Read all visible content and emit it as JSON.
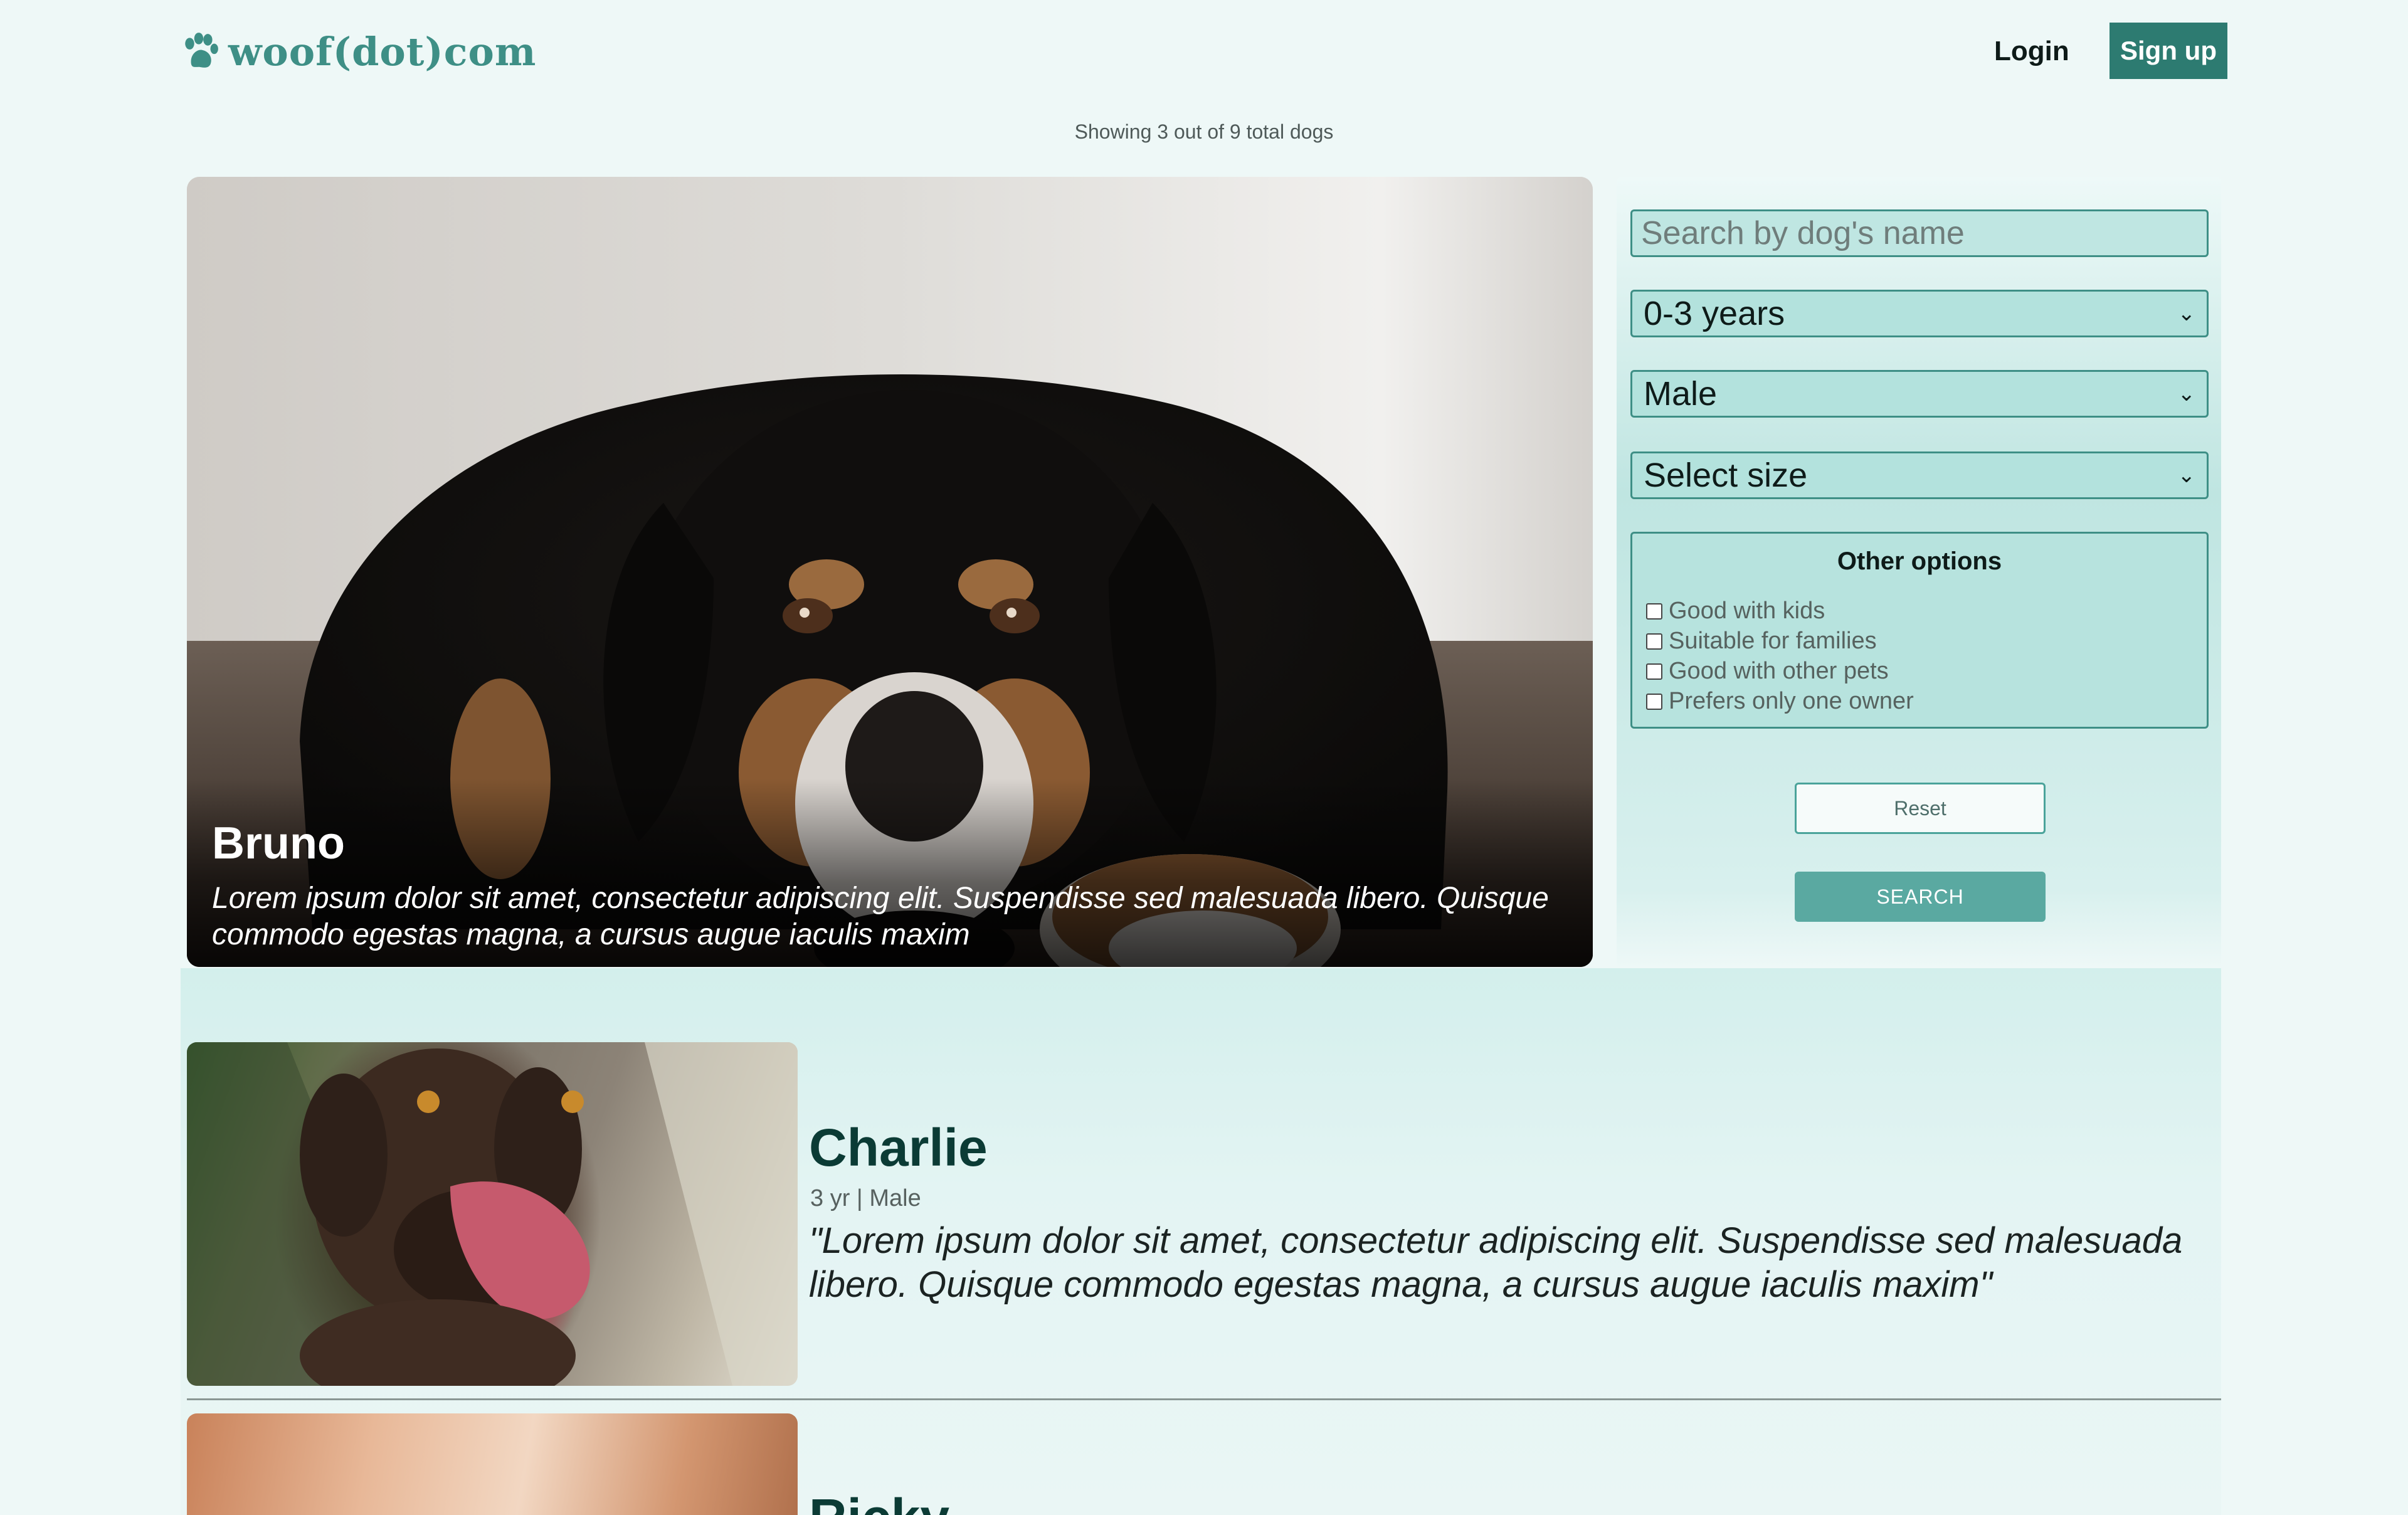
{
  "header": {
    "brand": "woof(dot)com",
    "login_label": "Login",
    "signup_label": "Sign up"
  },
  "summary": "Showing 3 out of 9 total dogs",
  "featured": {
    "name": "Bruno",
    "description": "Lorem ipsum dolor sit amet, consectetur adipiscing elit. Suspendisse sed malesuada libero. Quisque commodo egestas magna, a cursus augue iaculis maxim"
  },
  "filters": {
    "search_placeholder": "Search by dog's name",
    "age_selected": "0-3 years",
    "gender_selected": "Male",
    "size_selected": "Select size",
    "other_options_title": "Other options",
    "options": [
      {
        "label": "Good with kids",
        "checked": false
      },
      {
        "label": "Suitable for families",
        "checked": false
      },
      {
        "label": "Good with other pets",
        "checked": false
      },
      {
        "label": "Prefers only one owner",
        "checked": false
      }
    ],
    "reset_label": "Reset",
    "search_label": "SEARCH"
  },
  "dogs": [
    {
      "name": "Charlie",
      "meta": "3 yr | Male",
      "quote": "\"Lorem ipsum dolor sit amet, consectetur adipiscing elit. Suspendisse sed malesuada libero. Quisque commodo egestas magna, a cursus augue iaculis maxim\""
    },
    {
      "name": "Ricky"
    }
  ],
  "colors": {
    "brand": "#3e8f86",
    "signup_bg": "#2d7b71",
    "search_button": "#5aa9a1",
    "page_bg": "#eef8f7"
  }
}
